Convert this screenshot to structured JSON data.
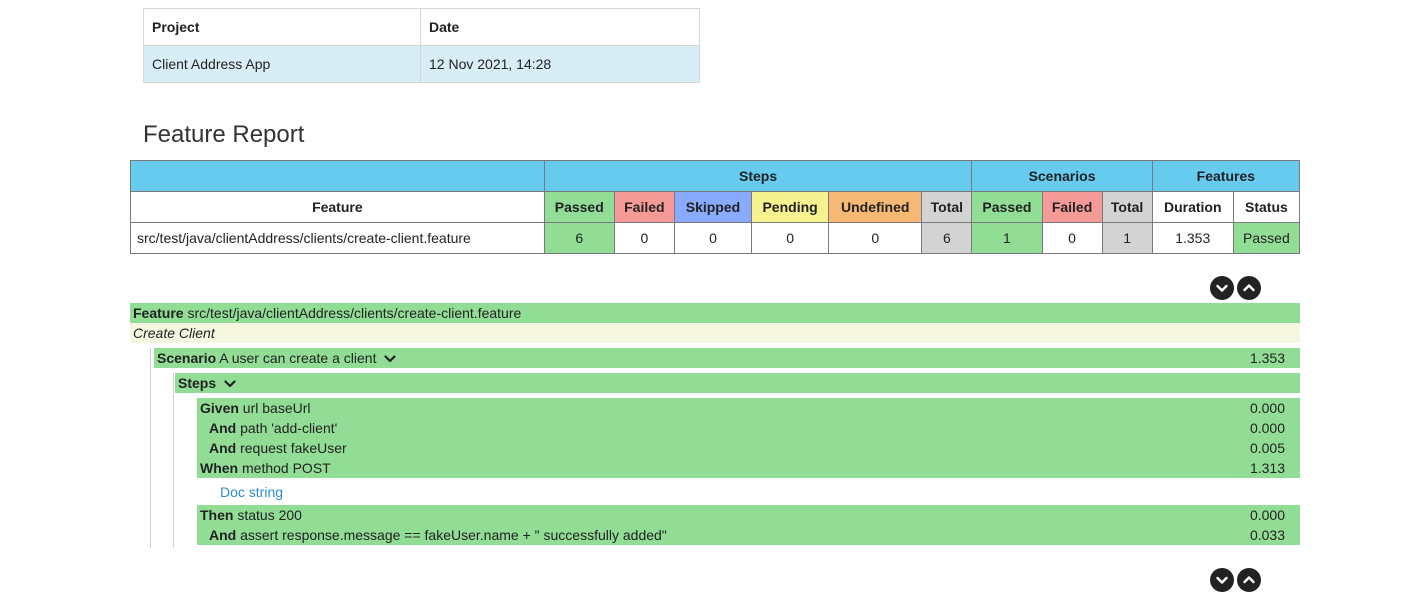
{
  "meta": {
    "headers": [
      "Project",
      "Date"
    ],
    "values": [
      "Client Address App",
      "12 Nov 2021, 14:28"
    ]
  },
  "title": "Feature Report",
  "report": {
    "groups": [
      "Steps",
      "Scenarios",
      "Features"
    ],
    "columns": [
      "Feature",
      "Passed",
      "Failed",
      "Skipped",
      "Pending",
      "Undefined",
      "Total",
      "Passed",
      "Failed",
      "Total",
      "Duration",
      "Status"
    ],
    "row": [
      "src/test/java/clientAddress/clients/create-client.feature",
      "6",
      "0",
      "0",
      "0",
      "0",
      "6",
      "1",
      "0",
      "1",
      "1.353",
      "Passed"
    ]
  },
  "feature": {
    "keyword": "Feature",
    "name": "src/test/java/clientAddress/clients/create-client.feature",
    "description": "Create Client",
    "scenario": {
      "keyword": "Scenario",
      "name": "A user can create a client",
      "duration": "1.353"
    },
    "steps_label": "Steps",
    "steps": [
      {
        "keyword": "Given",
        "text": "url baseUrl",
        "duration": "0.000"
      },
      {
        "keyword": "And",
        "text": "path 'add-client'",
        "duration": "0.000"
      },
      {
        "keyword": "And",
        "text": "request fakeUser",
        "duration": "0.005"
      },
      {
        "keyword": "When",
        "text": "method POST",
        "duration": "1.313"
      },
      {
        "keyword": "Then",
        "text": "status 200",
        "duration": "0.000"
      },
      {
        "keyword": "And",
        "text": "assert response.message == fakeUser.name + \" successfully added\"",
        "duration": "0.033"
      }
    ],
    "doc_string_link": "Doc string"
  },
  "icons": {
    "expand": "chevron-down-icon",
    "collapse": "chevron-up-icon"
  },
  "colors": {
    "passed": "#92dd96",
    "failed": "#f59a96",
    "skipped": "#88aaff",
    "pending": "#f5f28f",
    "undefined": "#f5b975",
    "total": "#d3d3d3",
    "header": "#66cbef"
  }
}
